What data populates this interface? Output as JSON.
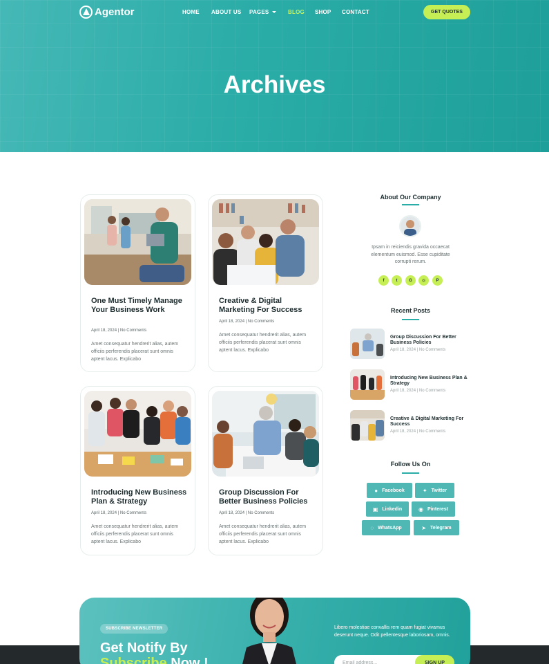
{
  "brand": {
    "name": "Agentor"
  },
  "nav": {
    "items": [
      {
        "label": "HOME"
      },
      {
        "label": "ABOUT US"
      },
      {
        "label": "PAGES"
      },
      {
        "label": "BLOG"
      },
      {
        "label": "SHOP"
      },
      {
        "label": "CONTACT"
      }
    ],
    "cta": "GET QUOTES"
  },
  "hero": {
    "title": "Archives"
  },
  "posts": [
    {
      "title": "One Must Timely Manage Your Business Work",
      "meta": "April 18, 2024 | No Comments",
      "excerpt": "Amet consequatur hendrerit alias, autem officiis perferendis placerat sunt omnis aptent lacus. Explicabo"
    },
    {
      "title": "Creative & Digital Marketing For Success",
      "meta": "April 18, 2024 | No Comments",
      "excerpt": "Amet consequatur hendrerit alias, autem officiis perferendis placerat sunt omnis aptent lacus. Explicabo"
    },
    {
      "title": "Introducing New Business Plan & Strategy",
      "meta": "April 18, 2024 | No Comments",
      "excerpt": "Amet consequatur hendrerit alias, autem officiis perferendis placerat sunt omnis aptent lacus. Explicabo"
    },
    {
      "title": "Group Discussion For Better Business Policies",
      "meta": "April 18, 2024 | No Comments",
      "excerpt": "Amet consequatur hendrerit alias, autem officiis perferendis placerat sunt omnis aptent lacus. Explicabo"
    }
  ],
  "sidebar": {
    "about": {
      "heading": "About Our Company",
      "text": "Ipsam in reiciendis gravida occaecat elementum euismod. Esse cupiditate corrupti rerum.",
      "socials": [
        "f",
        "t",
        "G",
        "◎",
        "P"
      ]
    },
    "recent": {
      "heading": "Recent Posts",
      "items": [
        {
          "title": "Group Discussion For Better Business Policies",
          "meta": "April 18, 2024 | No Comments"
        },
        {
          "title": "Introducing New Business Plan & Strategy",
          "meta": "April 18, 2024 | No Comments"
        },
        {
          "title": "Creative & Digital Marketing For Success",
          "meta": "April 18, 2024 | No Comments"
        }
      ]
    },
    "follow": {
      "heading": "Follow Us On",
      "buttons": [
        {
          "label": "Facebook",
          "icon": "facebook-icon"
        },
        {
          "label": "Twitter",
          "icon": "twitter-icon"
        },
        {
          "label": "Linkedin",
          "icon": "linkedin-icon"
        },
        {
          "label": "Pinterest",
          "icon": "pinterest-icon"
        },
        {
          "label": "WhatsApp",
          "icon": "whatsapp-icon"
        },
        {
          "label": "Telegram",
          "icon": "telegram-icon"
        }
      ]
    }
  },
  "newsletter": {
    "badge": "SUBSCRIBE NEWSLETTER",
    "heading_line1": "Get Notify By",
    "heading_hl": "Subscribe",
    "heading_rest": " Now !",
    "text": "Libero molestiae convallis rem quam fugiat vivamus deserunt neque. Odit pellentesque laboriosam, omnis.",
    "email_placeholder": "Email address...",
    "button": "SIGN UP"
  },
  "colors": {
    "teal": "#2aaca7",
    "lime": "#c6ef55",
    "dark": "#24292b"
  }
}
